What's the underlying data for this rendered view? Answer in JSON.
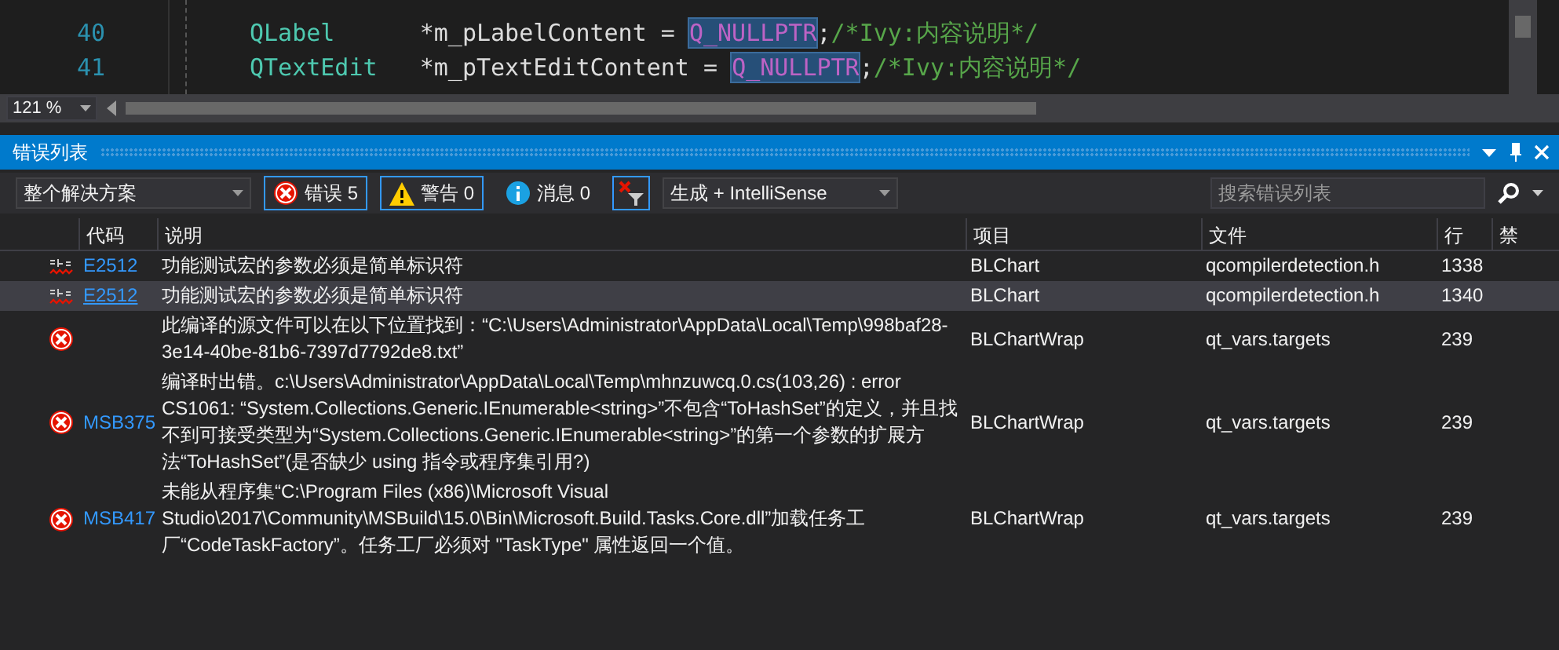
{
  "editor": {
    "lines": [
      {
        "number": "40",
        "tokens": [
          {
            "text": "QLabel      ",
            "kind": "type"
          },
          {
            "text": "*m_pLabelContent = ",
            "kind": "plain"
          },
          {
            "text": "Q_NULLPTR",
            "kind": "macro"
          },
          {
            "text": ";",
            "kind": "plain"
          },
          {
            "text": "/*Ivy:内容说明*/",
            "kind": "comment"
          }
        ]
      },
      {
        "number": "41",
        "tokens": [
          {
            "text": "QTextEdit   ",
            "kind": "type"
          },
          {
            "text": "*m_pTextEditContent = ",
            "kind": "plain"
          },
          {
            "text": "Q_NULLPTR",
            "kind": "macro"
          },
          {
            "text": ";",
            "kind": "plain"
          },
          {
            "text": "/*Ivy:内容说明*/",
            "kind": "comment"
          }
        ]
      }
    ],
    "zoom": "121 %"
  },
  "panel": {
    "title": "错误列表"
  },
  "toolbar": {
    "scope": "整个解决方案",
    "filters": [
      {
        "kind": "error",
        "label": "错误 5",
        "selected": true
      },
      {
        "kind": "warning",
        "label": "警告 0",
        "selected": true
      },
      {
        "kind": "info",
        "label": "消息 0",
        "selected": false
      }
    ],
    "filter_toggle": {
      "selected": true
    },
    "source": "生成 + IntelliSense",
    "search": {
      "placeholder": "搜索错误列表"
    }
  },
  "table": {
    "columns": [
      "代码",
      "说明",
      "项目",
      "文件",
      "行",
      "禁"
    ],
    "rows": [
      {
        "kind": "squiggle",
        "code": "E2512",
        "description": "功能测试宏的参数必须是简单标识符",
        "project": "BLChart",
        "file": "qcompilerdetection.h",
        "line": "1338",
        "selected": false
      },
      {
        "kind": "squiggle",
        "code": "E2512",
        "description": "功能测试宏的参数必须是简单标识符",
        "project": "BLChart",
        "file": "qcompilerdetection.h",
        "line": "1340",
        "selected": true
      },
      {
        "kind": "error",
        "description": "此编译的源文件可以在以下位置找到：“C:\\Users\\Administrator\\AppData\\Local\\Temp\\998baf28-3e14-40be-81b6-7397d7792de8.txt”",
        "project": "BLChartWrap",
        "file": "qt_vars.targets",
        "line": "239",
        "selected": false
      },
      {
        "kind": "error",
        "code": "MSB375",
        "description": "编译时出错。c:\\Users\\Administrator\\AppData\\Local\\Temp\\mhnzuwcq.0.cs(103,26) : error CS1061: “System.Collections.Generic.IEnumerable<string>”不包含“ToHashSet”的定义，并且找不到可接受类型为“System.Collections.Generic.IEnumerable<string>”的第一个参数的扩展方法“ToHashSet”(是否缺少 using 指令或程序集引用?)",
        "project": "BLChartWrap",
        "file": "qt_vars.targets",
        "line": "239",
        "selected": false
      },
      {
        "kind": "error",
        "code": "MSB417",
        "description": "未能从程序集“C:\\Program Files (x86)\\Microsoft Visual Studio\\2017\\Community\\MSBuild\\15.0\\Bin\\Microsoft.Build.Tasks.Core.dll”加载任务工厂“CodeTaskFactory”。任务工厂必须对 \"TaskType\" 属性返回一个值。",
        "project": "BLChartWrap",
        "file": "qt_vars.targets",
        "line": "239",
        "selected": false
      }
    ]
  }
}
